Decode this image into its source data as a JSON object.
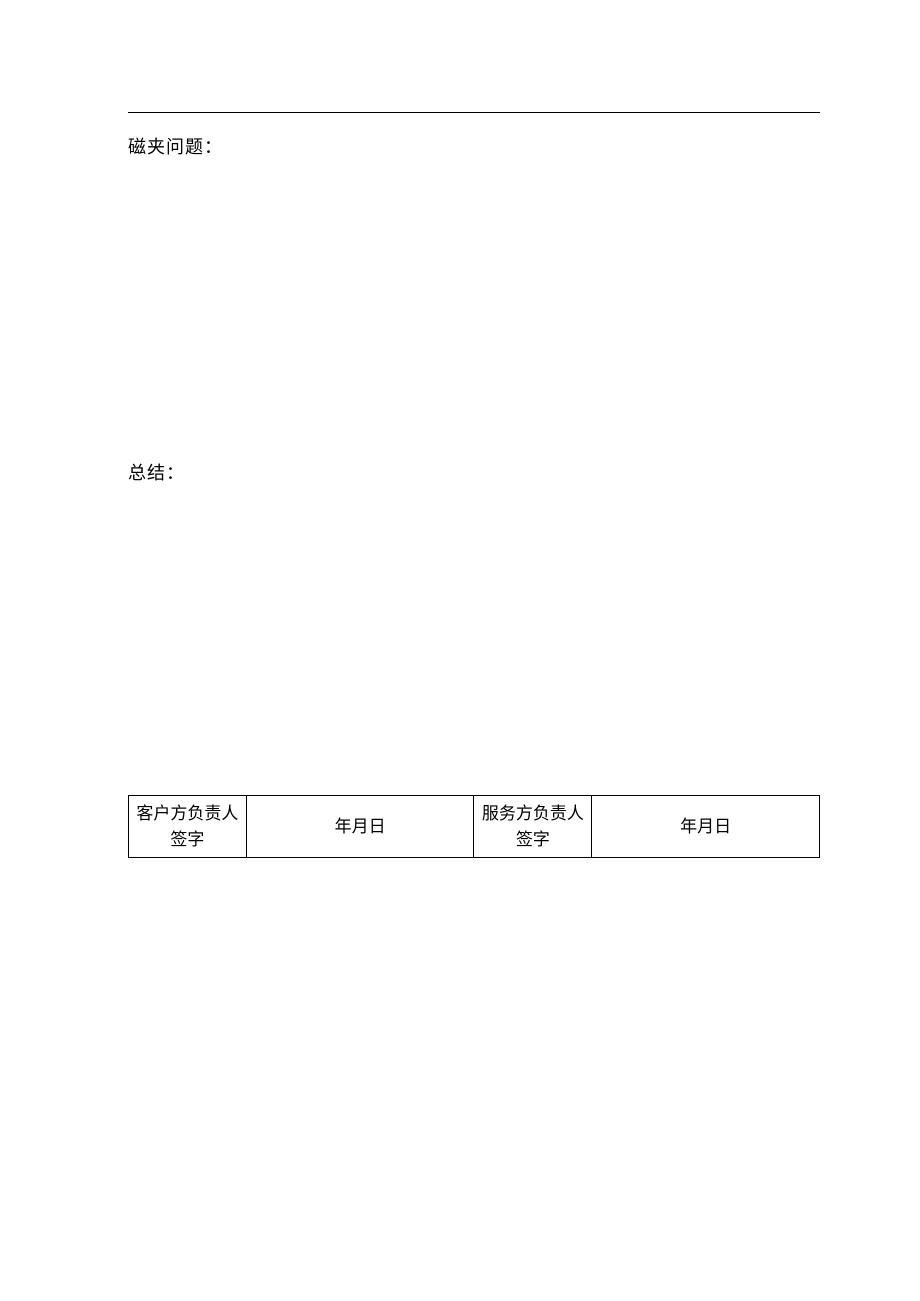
{
  "sections": {
    "issue_label": "磁夹问题：",
    "summary_label": "总结："
  },
  "signature_table": {
    "client_label": "客户方负责人签字",
    "client_date": "年月日",
    "service_label": "服务方负责人签字",
    "service_date": "年月日"
  }
}
